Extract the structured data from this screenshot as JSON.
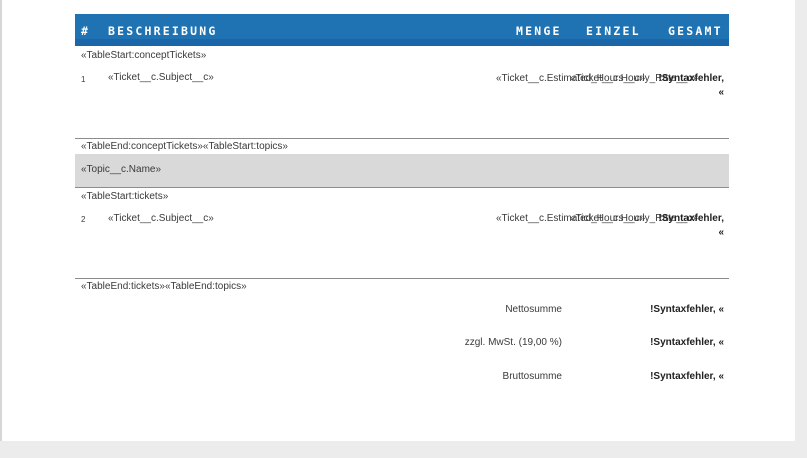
{
  "header": {
    "col_num": "#",
    "col_desc": "BESCHREIBUNG",
    "col_qty": "MENGE",
    "col_unit": "EINZEL",
    "col_total": "GESAMT"
  },
  "rows": {
    "concept_start": "«TableStart:conceptTickets»",
    "row1": {
      "num": "1",
      "subject": "«Ticket__c.Subject__c»",
      "hours": "«Ticket__c.Estimated_Hours__c»",
      "rate": "«Ticket__c.Hourly_Rate__c»",
      "total": "!Syntaxfehler, «"
    },
    "concept_end_topics_start": "«TableEnd:conceptTickets»«TableStart:topics»",
    "topic_name": "«Topic__c.Name»",
    "tickets_start": "«TableStart:tickets»",
    "row2": {
      "num": "2",
      "subject": "«Ticket__c.Subject__c»",
      "hours": "«Ticket__c.Estimated_Hours__c»",
      "rate": "«Ticket__c.Hourly_Rate__c»",
      "total": "!Syntaxfehler, «"
    },
    "tickets_end_topics_end": "«TableEnd:tickets»«TableEnd:topics»"
  },
  "summary": {
    "net_label": "Nettosumme",
    "net_value": "!Syntaxfehler, «",
    "vat_label": "zzgl. MwSt. (19,00 %)",
    "vat_value": "!Syntaxfehler, «",
    "gross_label": "Bruttosumme",
    "gross_value": "!Syntaxfehler, «"
  },
  "colors": {
    "header_bg": "#1f73b3",
    "topic_band_bg": "#d9d9d9"
  }
}
